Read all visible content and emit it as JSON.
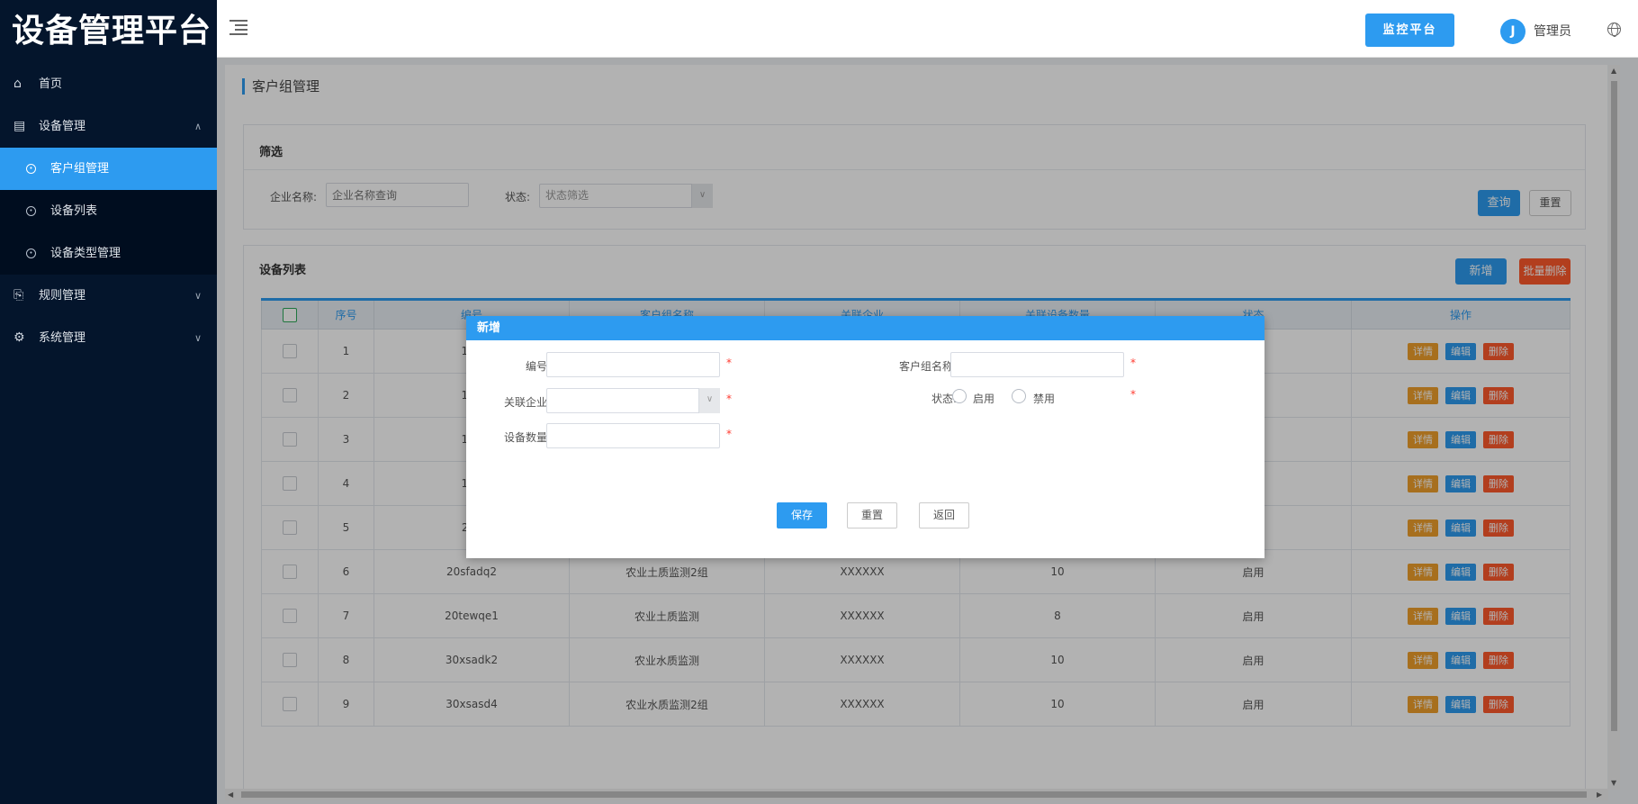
{
  "app": {
    "title": "设备管理平台"
  },
  "sidebar": {
    "items": [
      {
        "label": "首页",
        "icon": "home-icon"
      },
      {
        "label": "设备管理",
        "icon": "device-icon",
        "expanded": true,
        "children": [
          {
            "label": "客户组管理",
            "active": true
          },
          {
            "label": "设备列表"
          },
          {
            "label": "设备类型管理"
          }
        ]
      },
      {
        "label": "规则管理",
        "icon": "rule-icon"
      },
      {
        "label": "系统管理",
        "icon": "settings-icon"
      }
    ]
  },
  "header": {
    "monitor_button": "监控平台",
    "user_name": "管理员",
    "avatar_letter": "J"
  },
  "page": {
    "title": "客户组管理"
  },
  "filter": {
    "title": "筛选",
    "company_label": "企业名称:",
    "company_placeholder": "企业名称查询",
    "status_label": "状态:",
    "status_placeholder": "状态筛选",
    "query_button": "查询",
    "reset_button": "重置"
  },
  "list": {
    "title": "设备列表",
    "add_button": "新增",
    "batch_delete_button": "批量删除",
    "columns": [
      "序号",
      "编号",
      "客户组名称",
      "关联企业",
      "关联设备数量",
      "状态",
      "操作"
    ],
    "actions": {
      "detail": "详情",
      "edit": "编辑",
      "delete": "删除"
    },
    "rows": [
      {
        "index": "1",
        "code": "100",
        "name": "",
        "company": "",
        "count": "",
        "status": ""
      },
      {
        "index": "2",
        "code": "102",
        "name": "",
        "company": "",
        "count": "",
        "status": ""
      },
      {
        "index": "3",
        "code": "102",
        "name": "",
        "company": "",
        "count": "",
        "status": ""
      },
      {
        "index": "4",
        "code": "104",
        "name": "",
        "company": "",
        "count": "",
        "status": ""
      },
      {
        "index": "5",
        "code": "20x",
        "name": "",
        "company": "",
        "count": "",
        "status": ""
      },
      {
        "index": "6",
        "code": "20sfadq2",
        "name": "农业土质监测2组",
        "company": "XXXXXX",
        "count": "10",
        "status": "启用"
      },
      {
        "index": "7",
        "code": "20tewqe1",
        "name": "农业土质监测",
        "company": "XXXXXX",
        "count": "8",
        "status": "启用"
      },
      {
        "index": "8",
        "code": "30xsadk2",
        "name": "农业水质监测",
        "company": "XXXXXX",
        "count": "10",
        "status": "启用"
      },
      {
        "index": "9",
        "code": "30xsasd4",
        "name": "农业水质监测2组",
        "company": "XXXXXX",
        "count": "10",
        "status": "启用"
      }
    ]
  },
  "modal": {
    "title": "新增",
    "code_label": "编号:",
    "name_label": "客户组名称:",
    "company_label": "关联企业:",
    "status_label": "状态:",
    "status_enable": "启用",
    "status_disable": "禁用",
    "count_label": "设备数量:",
    "required_mark": "*",
    "save_button": "保存",
    "reset_button": "重置",
    "back_button": "返回"
  }
}
